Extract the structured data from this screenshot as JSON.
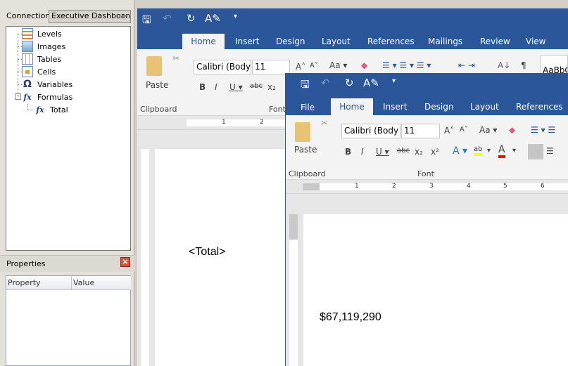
{
  "left_panel": {
    "connection_label": "Connection",
    "connection_value": "Executive Dashboard",
    "tree": [
      {
        "label": "Levels",
        "icon": "levels-icon"
      },
      {
        "label": "Images",
        "icon": "images-icon"
      },
      {
        "label": "Tables",
        "icon": "tables-icon"
      },
      {
        "label": "Cells",
        "icon": "cells-icon"
      },
      {
        "label": "Variables",
        "icon": "omega-icon"
      },
      {
        "label": "Formulas",
        "icon": "fx-icon"
      },
      {
        "label": "Total",
        "icon": "fx-icon"
      }
    ],
    "properties": {
      "title": "Properties",
      "columns": [
        "Property",
        "Value"
      ]
    }
  },
  "word_back": {
    "tabs": [
      "Home",
      "Insert",
      "Design",
      "Layout",
      "References",
      "Mailings",
      "Review",
      "View"
    ],
    "font": "Calibri (Body",
    "size": "11",
    "paste": "Paste",
    "clipboard": "Clipboard",
    "font_group": "Font",
    "style_preview": "AaBbC",
    "doc_text": "<Total>",
    "ruler": [
      "1",
      "2"
    ]
  },
  "word_front": {
    "tabs": [
      "File",
      "Home",
      "Insert",
      "Design",
      "Layout",
      "References"
    ],
    "font": "Calibri (Body",
    "size": "11",
    "paste": "Paste",
    "clipboard": "Clipboard",
    "font_group": "Font",
    "doc_text": "$67,119,290",
    "ruler": [
      "1",
      "2",
      "3",
      "4",
      "5",
      "6"
    ]
  },
  "colors": {
    "word_blue": "#2b579a",
    "highlight": "#ffff00",
    "font_color": "#ff0000"
  }
}
